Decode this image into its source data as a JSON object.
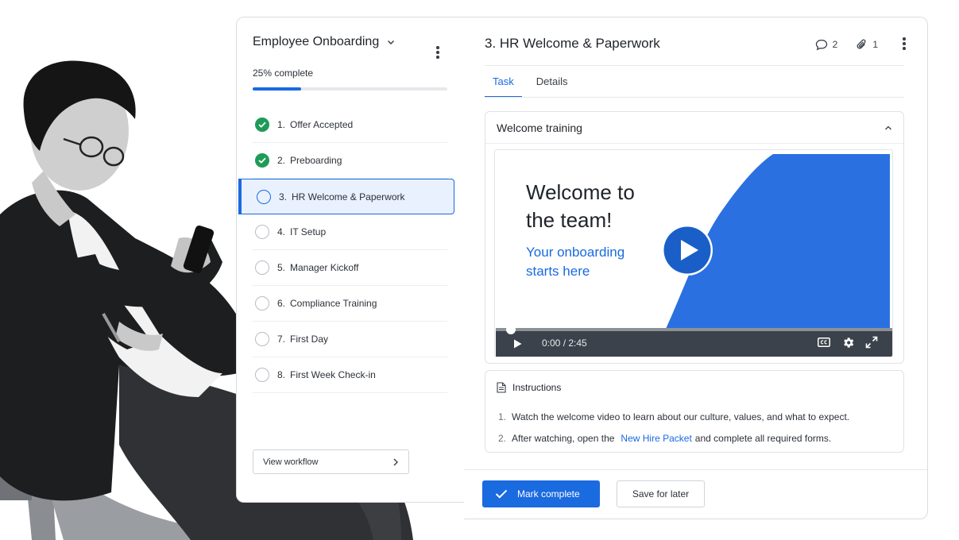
{
  "workflow": {
    "title": "Employee Onboarding",
    "progress_label": "25% complete",
    "progress_fraction": 0.25,
    "steps": [
      {
        "num": "1.",
        "label": "Offer Accepted",
        "status": "done"
      },
      {
        "num": "2.",
        "label": "Preboarding",
        "status": "done"
      },
      {
        "num": "3.",
        "label": "HR Welcome & Paperwork",
        "status": "active"
      },
      {
        "num": "4.",
        "label": "IT Setup",
        "status": "todo"
      },
      {
        "num": "5.",
        "label": "Manager Kickoff",
        "status": "todo"
      },
      {
        "num": "6.",
        "label": "Compliance Training",
        "status": "todo"
      },
      {
        "num": "7.",
        "label": "First Day",
        "status": "todo"
      },
      {
        "num": "8.",
        "label": "First Week Check-in",
        "status": "todo"
      }
    ],
    "view_button": "View workflow"
  },
  "task": {
    "title": "3.  HR Welcome & Paperwork",
    "comments_count": "2",
    "attachments_count": "1",
    "tabs": [
      {
        "label": "Task",
        "active": true
      },
      {
        "label": "Details",
        "active": false
      }
    ],
    "section_title": "Welcome training",
    "video": {
      "headline": "Welcome to the team!",
      "subhead": "Your onboarding starts here",
      "time": "0:00 / 2:45"
    },
    "instructions": {
      "title": "Instructions",
      "item1": "Watch the welcome video to learn about our culture, values, and what to expect.",
      "item2_before": "After watching, open the",
      "item2_link": "New Hire Packet",
      "item2_after": "and complete all required forms."
    },
    "primary_button": "Mark complete",
    "secondary_button": "Save for later"
  },
  "colors": {
    "accent": "#1a6ae0",
    "success": "#1e9b57",
    "video_controls": "#3b424b"
  }
}
